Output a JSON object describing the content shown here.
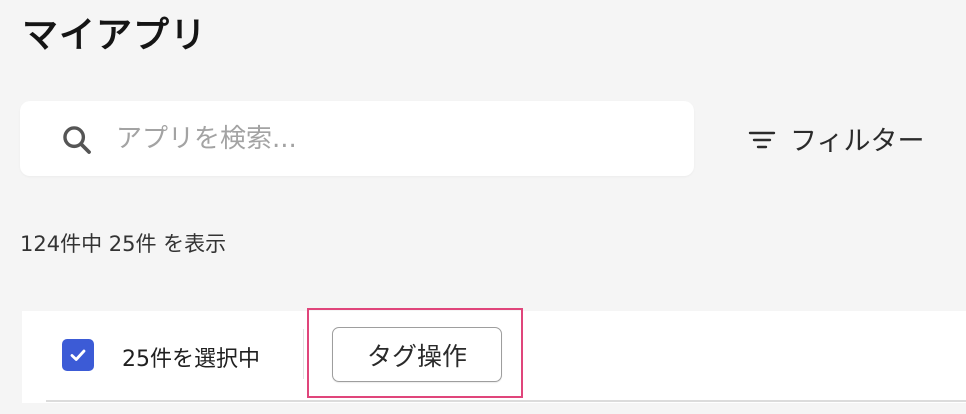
{
  "page": {
    "title": "マイアプリ"
  },
  "search": {
    "placeholder": "アプリを検索...",
    "value": "",
    "icon": "search-icon"
  },
  "filter": {
    "label": "フィルター",
    "icon": "filter-icon"
  },
  "results": {
    "count_text": "124件中 25件 を表示"
  },
  "selection": {
    "checked": true,
    "label": "25件を選択中",
    "tag_button_label": "タグ操作"
  },
  "colors": {
    "background": "#f5f5f5",
    "checkbox": "#3c5bd6",
    "highlight": "#e0457b"
  }
}
